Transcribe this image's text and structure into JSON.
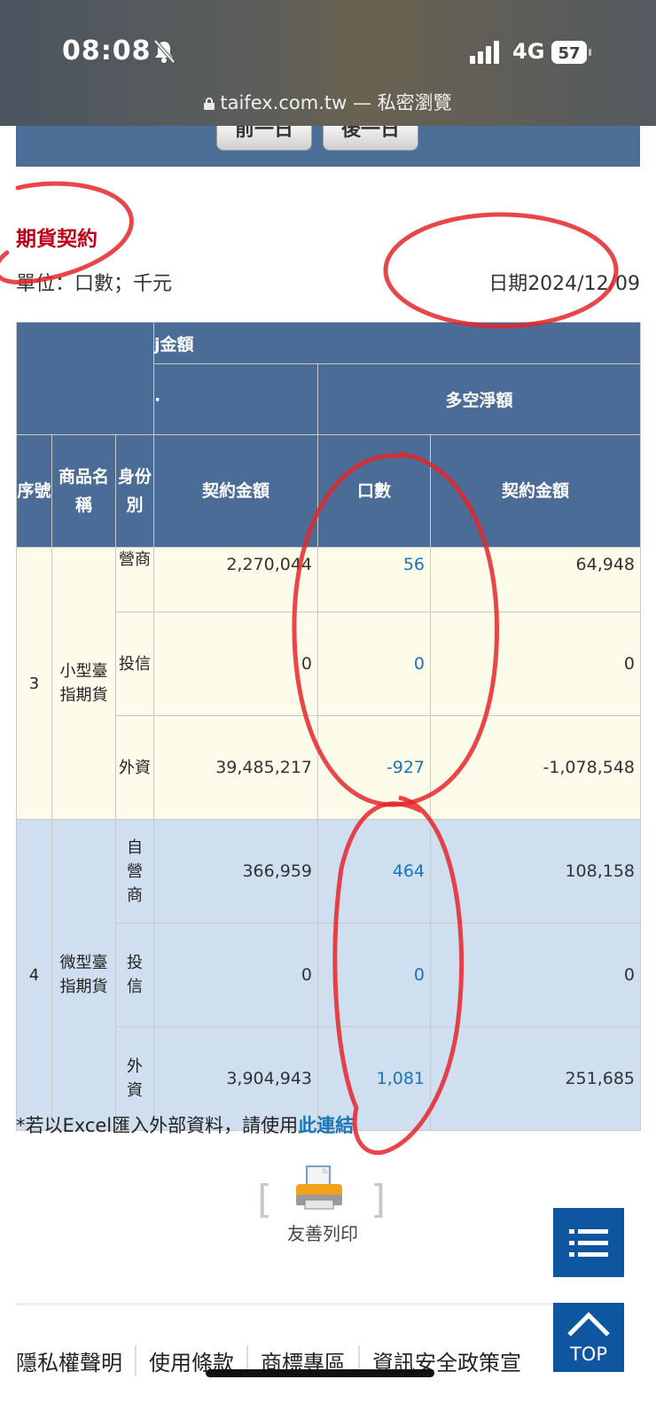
{
  "status_bar": {
    "time": "08:08",
    "network": "4G",
    "battery": "57"
  },
  "browser": {
    "url": "taifex.com.tw — 私密瀏覽"
  },
  "nav": {
    "prev_label": "前一日",
    "next_label": "後一日"
  },
  "section_title": "期貨契約",
  "unit_label": "單位：口數；千元",
  "date_label": "日期2024/12/09",
  "table": {
    "group_header": "j金額",
    "left_sub_mark": "·",
    "sub_header": "多空淨額",
    "columns": {
      "index": "序號",
      "product": "商品名稱",
      "identity": "身份別",
      "contract_amount": "契約金額",
      "lots": "口數",
      "net_contract_amount": "契約金額"
    },
    "groups": [
      {
        "index": "3",
        "product": "小型臺指期貨",
        "rows": [
          {
            "identity": "營商",
            "contract_amount": "2,270,044",
            "lots": "56",
            "net_amount": "64,948"
          },
          {
            "identity": "投信",
            "contract_amount": "0",
            "lots": "0",
            "net_amount": "0"
          },
          {
            "identity": "外資",
            "contract_amount": "39,485,217",
            "lots": "-927",
            "net_amount": "-1,078,548"
          }
        ]
      },
      {
        "index": "4",
        "product": "微型臺指期貨",
        "rows": [
          {
            "identity": "自營商",
            "contract_amount": "366,959",
            "lots": "464",
            "net_amount": "108,158"
          },
          {
            "identity": "投信",
            "contract_amount": "0",
            "lots": "0",
            "net_amount": "0"
          },
          {
            "identity": "外資",
            "contract_amount": "3,904,943",
            "lots": "1,081",
            "net_amount": "251,685"
          }
        ]
      }
    ]
  },
  "excel_note": {
    "text": "*若以Excel匯入外部資料，請使用",
    "link": "此連結"
  },
  "print": {
    "bracket_left": "[",
    "bracket_right": "]",
    "label": "友善列印"
  },
  "float": {
    "top_label": "TOP"
  },
  "footer": {
    "links": [
      "隱私權聲明",
      "使用條款",
      "商標專區",
      "資訊安全政策宣"
    ]
  },
  "colors": {
    "header_blue": "#4a6c96",
    "link_blue": "#1a74b6",
    "title_red": "#c0001a",
    "float_blue": "#0f56a1",
    "annotation_red": "#e5262c"
  }
}
